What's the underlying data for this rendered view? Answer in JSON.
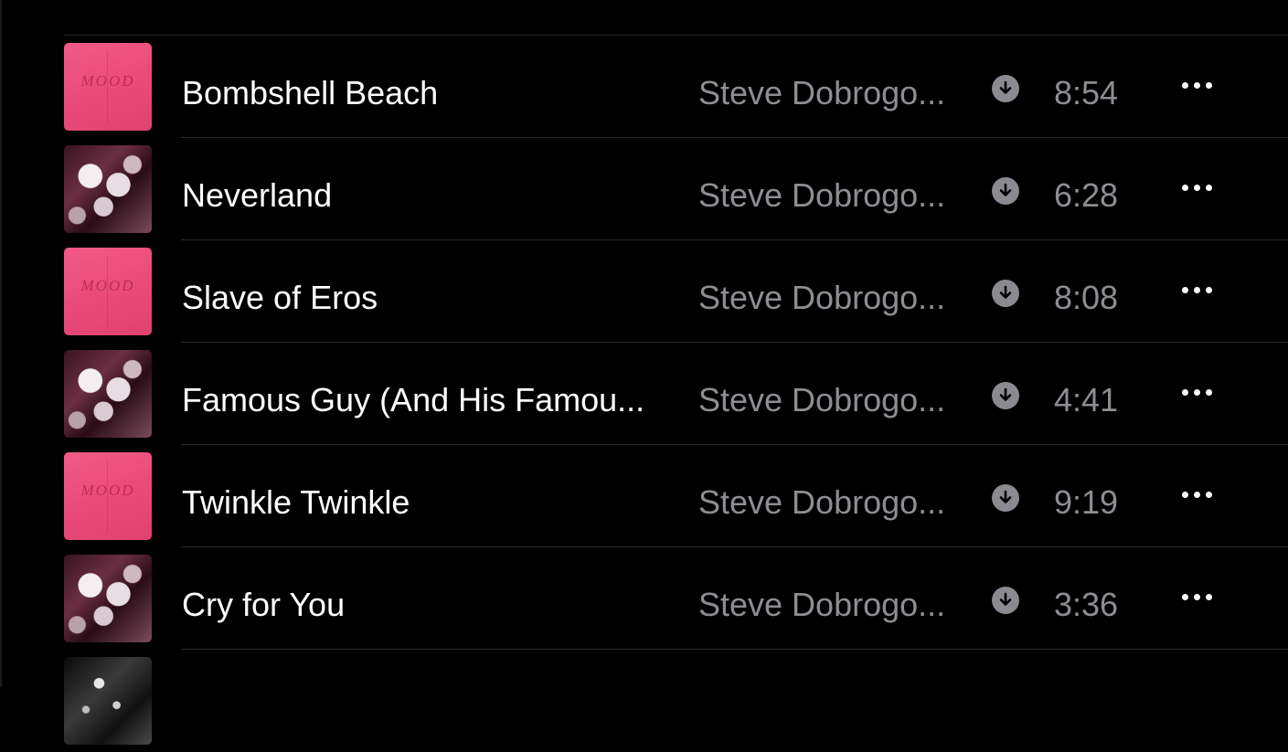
{
  "tracks": [
    {
      "title": "Bombshell Beach",
      "artist": "Steve Dobrogo...",
      "duration": "8:54",
      "artwork": "pink",
      "art_text": "MOOD"
    },
    {
      "title": "Neverland",
      "artist": "Steve Dobrogo...",
      "duration": "6:28",
      "artwork": "photo"
    },
    {
      "title": "Slave of Eros",
      "artist": "Steve Dobrogo...",
      "duration": "8:08",
      "artwork": "pink",
      "art_text": "MOOD"
    },
    {
      "title": "Famous Guy (And His Famou...",
      "artist": "Steve Dobrogo...",
      "duration": "4:41",
      "artwork": "photo"
    },
    {
      "title": "Twinkle Twinkle",
      "artist": "Steve Dobrogo...",
      "duration": "9:19",
      "artwork": "pink",
      "art_text": "MOOD"
    },
    {
      "title": "Cry for You",
      "artist": "Steve Dobrogo...",
      "duration": "3:36",
      "artwork": "photo"
    },
    {
      "title": "",
      "artist": "",
      "duration": "",
      "artwork": "bw"
    }
  ],
  "icons": {
    "download": "download-circle-icon",
    "more": "more-options-icon"
  },
  "colors": {
    "background": "#000000",
    "title_text": "#ffffff",
    "secondary_text": "#8d8d93",
    "divider": "#2a2a2c",
    "artwork_pink": "#ee5282"
  }
}
